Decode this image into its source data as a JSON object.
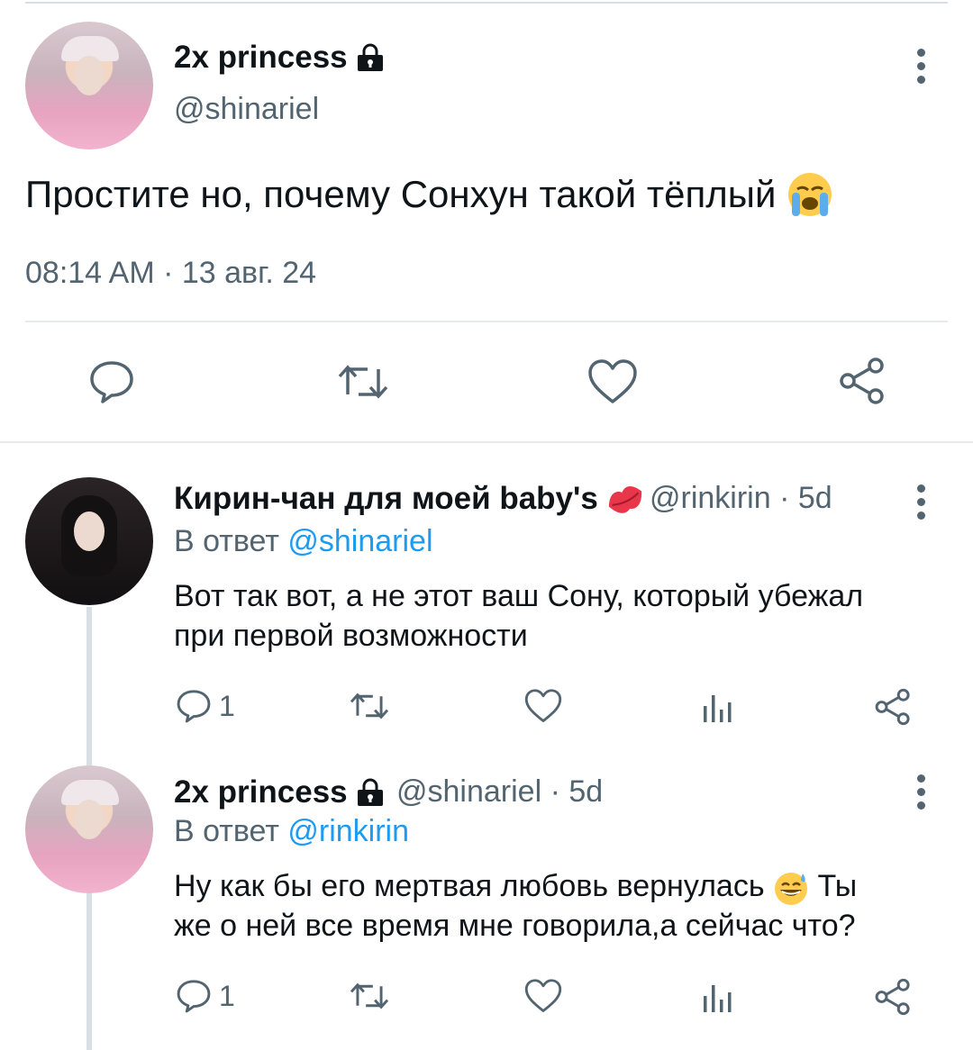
{
  "main_tweet": {
    "display_name": "2x princess",
    "handle": "@shinariel",
    "text": "Простите но, почему Сонхун такой тёплый",
    "emoji": "crying-face",
    "timestamp": "08:14 AM · 13 авг. 24"
  },
  "replies": [
    {
      "display_name": "Кирин-чан для моей baby's",
      "handle": "@rinkirin",
      "time": "· 5d",
      "reply_prefix": "В ответ",
      "reply_to": "@shinariel",
      "text_line1": "Вот так вот, а не этот ваш Сону, который убежал",
      "text_line2": "при первой возможности",
      "reply_count": "1",
      "name_emoji": "kiss-lips"
    },
    {
      "display_name": "2x princess",
      "handle": "@shinariel",
      "time": "· 5d",
      "reply_prefix": "В ответ",
      "reply_to": "@rinkirin",
      "text_line1_a": "Ну как бы его мертвая любовь вернулась",
      "text_line1_b": "Ты",
      "text_line2": "же о ней все время мне говорила,а сейчас что?",
      "reply_count": "1",
      "text_emoji": "grinning-face-with-sweat"
    }
  ],
  "colors": {
    "text": "#0f1419",
    "secondary": "#536471",
    "link": "#1d9bf0",
    "divider": "#e6eaed"
  }
}
